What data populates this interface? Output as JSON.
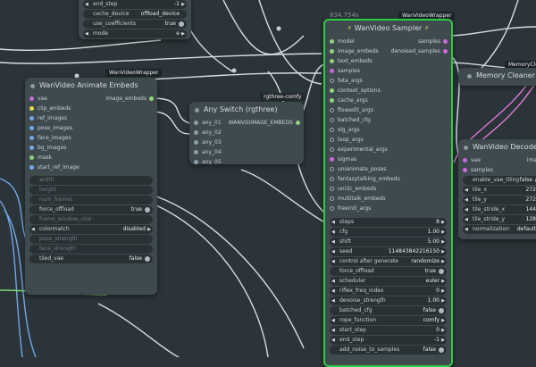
{
  "badges": {
    "wrapper_left": "WanVideoWrapper",
    "wrapper_sampler": "WanVideoWrapper",
    "rgthree": "rgthree-comfy",
    "memory_clean_tab": "MemoryCle",
    "sampler_size": "834.754s"
  },
  "top_node": {
    "widgets": [
      {
        "label": "end_step",
        "value": "-1"
      },
      {
        "label": "cache_device",
        "value": "offload_device"
      },
      {
        "label": "use_coefficients",
        "value": "true"
      },
      {
        "label": "mode",
        "value": "e"
      }
    ]
  },
  "animate_embeds": {
    "title": "WanVideo Animate Embeds",
    "inputs": [
      "vae",
      "clip_embeds",
      "ref_images",
      "pose_images",
      "face_images",
      "bg_images",
      "mask",
      "start_ref_image"
    ],
    "output": "image_embeds",
    "widgets": [
      {
        "label": "width",
        "value": "",
        "disabled": true
      },
      {
        "label": "height",
        "value": "",
        "disabled": true
      },
      {
        "label": "num_frames",
        "value": "",
        "disabled": true
      },
      {
        "label": "force_offload",
        "value": "true",
        "disabled": false
      },
      {
        "label": "frame_window_size",
        "value": "",
        "disabled": true
      },
      {
        "label": "colormatch",
        "value": "disabled",
        "disabled": false
      },
      {
        "label": "pose_strength",
        "value": "",
        "disabled": true
      },
      {
        "label": "face_strength",
        "value": "",
        "disabled": true
      },
      {
        "label": "tiled_vae",
        "value": "false",
        "disabled": false
      }
    ]
  },
  "any_switch": {
    "title": "Any Switch (rgthree)",
    "inputs": [
      "any_01",
      "any_02",
      "any_03",
      "any_04",
      "any_05"
    ],
    "output": "WANVIDIMAGE_EMBEDS"
  },
  "sampler": {
    "title": "WanVideo Sampler",
    "inputs": [
      "model",
      "image_embeds",
      "text_embeds",
      "samples",
      "feta_args",
      "context_options",
      "cache_args",
      "flowedit_args",
      "batched_cfg",
      "slg_args",
      "loop_args",
      "experimental_args",
      "sigmas",
      "unianimate_poses",
      "fantasytalking_embeds",
      "uni3c_embeds",
      "multitalk_embeds",
      "freeinit_args"
    ],
    "outputs": [
      "samples",
      "denoised_samples"
    ],
    "widgets": [
      {
        "label": "steps",
        "value": "8",
        "arrows": true
      },
      {
        "label": "cfg",
        "value": "1.00",
        "arrows": true
      },
      {
        "label": "shift",
        "value": "5.00",
        "arrows": true
      },
      {
        "label": "seed",
        "value": "114843842216150",
        "arrows": true
      },
      {
        "label": "control after generate",
        "value": "randomize",
        "arrows": true
      },
      {
        "label": "force_offload",
        "value": "true",
        "arrows": false
      },
      {
        "label": "scheduler",
        "value": "euler",
        "arrows": true
      },
      {
        "label": "riflex_freq_index",
        "value": "0",
        "arrows": true
      },
      {
        "label": "denoise_strength",
        "value": "1.00",
        "arrows": true
      },
      {
        "label": "batched_cfg",
        "value": "false",
        "arrows": false
      },
      {
        "label": "rope_function",
        "value": "comfy",
        "arrows": true
      },
      {
        "label": "start_step",
        "value": "0",
        "arrows": true
      },
      {
        "label": "end_step",
        "value": "-1",
        "arrows": true
      },
      {
        "label": "add_noise_to_samples",
        "value": "false",
        "arrows": false
      }
    ]
  },
  "memory_cleaner": {
    "title": "Memory Cleaner (For"
  },
  "decode": {
    "title": "WanVideo Decode",
    "inputs": [
      "vae",
      "samples"
    ],
    "output": "ima",
    "widgets": [
      {
        "label": "enable_vae_tiling",
        "value": "false"
      },
      {
        "label": "tile_x",
        "value": "272"
      },
      {
        "label": "tile_y",
        "value": "272"
      },
      {
        "label": "tile_stride_x",
        "value": "144"
      },
      {
        "label": "tile_stride_y",
        "value": "128"
      },
      {
        "label": "normalization",
        "value": "default"
      }
    ]
  },
  "colors": {
    "canvas": "#2b3438",
    "node": "#3f4a4f",
    "sampler_border": "#2ecc40",
    "wire_white": "#d8dde0",
    "wire_blue": "#74a7e8",
    "wire_pink": "#e07ad8",
    "wire_green": "#7bd66f"
  }
}
